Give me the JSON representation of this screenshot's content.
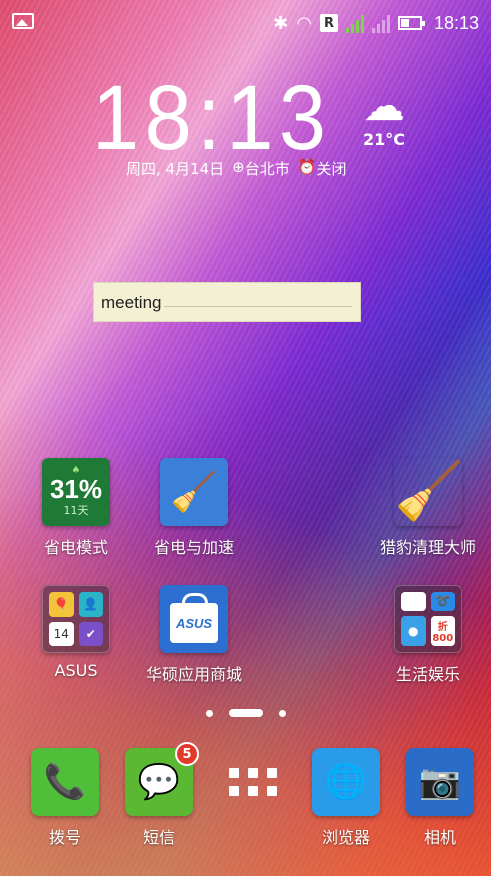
{
  "status_bar": {
    "time": "18:13",
    "roaming_badge": "R",
    "data_indicator": "1",
    "icons": [
      "gallery-icon",
      "bluetooth-icon",
      "wifi-icon",
      "signal-icon",
      "battery-icon"
    ]
  },
  "clock_widget": {
    "time": "18:13",
    "date": "周四, 4月14日",
    "location": "台北市",
    "alarm": "关闭",
    "temperature": "21°C",
    "weather_icon": "rain-cloud-icon"
  },
  "note_widget": {
    "text": "meeting"
  },
  "apps": [
    {
      "label": "省电模式",
      "icon_text": "31%",
      "sub_text": "11天"
    },
    {
      "label": "省电与加速"
    },
    {
      "label": "猎豹清理大师"
    },
    {
      "label": "ASUS",
      "tile_text": "14"
    },
    {
      "label": "华硕应用商城",
      "icon_text": "ASUS"
    },
    {
      "label": "生活娱乐",
      "tile_text": "折800"
    }
  ],
  "page_indicator": {
    "pages": 3,
    "current": 2
  },
  "dock": [
    {
      "label": "拨号"
    },
    {
      "label": "短信",
      "badge": "5"
    },
    {
      "label": "all-apps"
    },
    {
      "label": "浏览器"
    },
    {
      "label": "相机"
    }
  ]
}
